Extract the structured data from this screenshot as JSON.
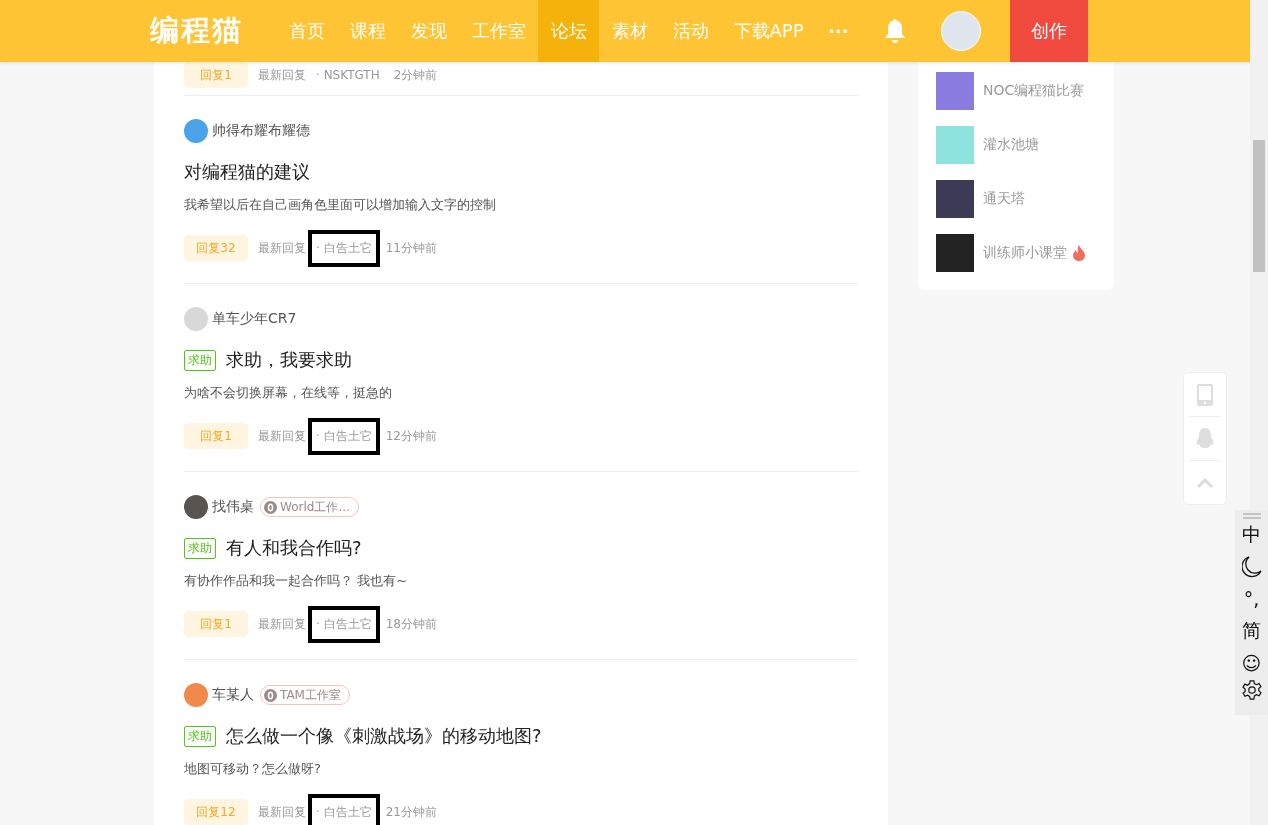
{
  "header": {
    "logo": "编程猫",
    "nav": [
      {
        "label": "首页",
        "selected": false
      },
      {
        "label": "课程",
        "selected": false
      },
      {
        "label": "发现",
        "selected": false
      },
      {
        "label": "工作室",
        "selected": false
      },
      {
        "label": "论坛",
        "selected": true
      },
      {
        "label": "素材",
        "selected": false
      },
      {
        "label": "活动",
        "selected": false
      },
      {
        "label": "下载APP",
        "selected": false
      }
    ],
    "more": "···",
    "create": "创作"
  },
  "partial_post": {
    "reply": "回复1",
    "latest_label": "最新回复",
    "latest_user": "· NSKTGTH",
    "time": "2分钟前",
    "highlighted": false
  },
  "posts": [
    {
      "author": "帅得布耀布耀德",
      "title": "对编程猫的建议",
      "description": "我希望以后在自己画角色里面可以增加输入文字的控制",
      "reply": "回复32",
      "latest_label": "最新回复",
      "latest_user": "· 白告土它",
      "time": "11分钟前",
      "highlighted": true
    },
    {
      "author": "单车少年CR7",
      "tag": "求助",
      "title": "求助，我要求助",
      "description": "为啥不会切换屏幕，在线等，挺急的",
      "reply": "回复1",
      "latest_label": "最新回复",
      "latest_user": "· 白告土它",
      "time": "12分钟前",
      "highlighted": true
    },
    {
      "author": "找伟桌",
      "studio": "World工作...",
      "tag": "求助",
      "title": "有人和我合作吗?",
      "description": "有协作作品和我一起合作吗？ 我也有~",
      "reply": "回复1",
      "latest_label": "最新回复",
      "latest_user": "· 白告土它",
      "time": "18分钟前",
      "highlighted": true
    },
    {
      "author": "车某人",
      "studio": "TAM工作室",
      "tag": "求助",
      "title": "怎么做一个像《刺激战场》的移动地图?",
      "description": "地图可移动？怎么做呀?",
      "reply": "回复12",
      "latest_label": "最新回复",
      "latest_user": "· 白告土它",
      "time": "21分钟前",
      "highlighted": true
    }
  ],
  "sidebar": {
    "items": [
      {
        "label": "NOC编程猫比赛",
        "hot": false
      },
      {
        "label": "灌水池塘",
        "hot": false
      },
      {
        "label": "通天塔",
        "hot": false
      },
      {
        "label": "训练师小课堂",
        "hot": true
      }
    ]
  },
  "ime": {
    "language": "中",
    "punctuation": "°,",
    "script": "简",
    "emoji": "☺"
  }
}
